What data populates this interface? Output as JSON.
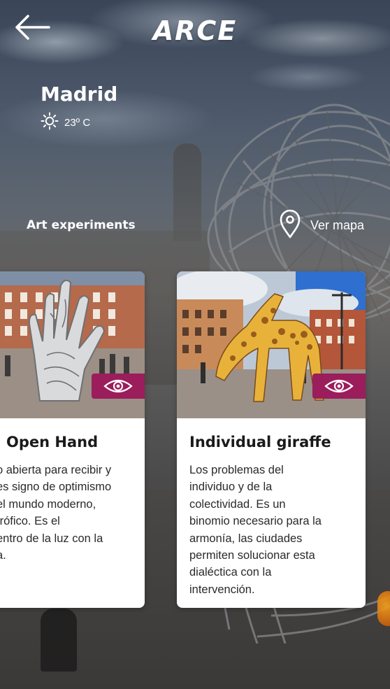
{
  "header": {
    "app_name": "ARCE",
    "back_icon": "arrow-left-icon"
  },
  "location": {
    "city": "Madrid",
    "weather_icon": "sun-icon",
    "temperature": "23º C"
  },
  "section": {
    "title": "Art experiments",
    "map_icon": "map-pin-icon",
    "map_link_label": "Ver mapa"
  },
  "cards": [
    {
      "title": "Open Hand",
      "image": "open-hand-sculpture-in-plaza",
      "view_icon": "eye-icon",
      "description_lines": [
        "o abierta para recibir y",
        "es signo de optimismo",
        "el mundo moderno,",
        "trófico. Es el",
        "entro de la luz con la",
        "a."
      ]
    },
    {
      "title": "Individual giraffe",
      "image": "giraffe-sculpture-in-plaza",
      "view_icon": "eye-icon",
      "description_lines": [
        "Los problemas del",
        "individuo y de la",
        "colectividad. Es un",
        "binomio necesario para la",
        "armonía, las ciudades",
        "permiten solucionar esta",
        "dialéctica con la",
        "intervención."
      ]
    }
  ],
  "colors": {
    "accent": "#9b1d5c",
    "card_background": "#ffffff",
    "text_primary": "#1a1a1a",
    "header_text": "#ffffff"
  }
}
